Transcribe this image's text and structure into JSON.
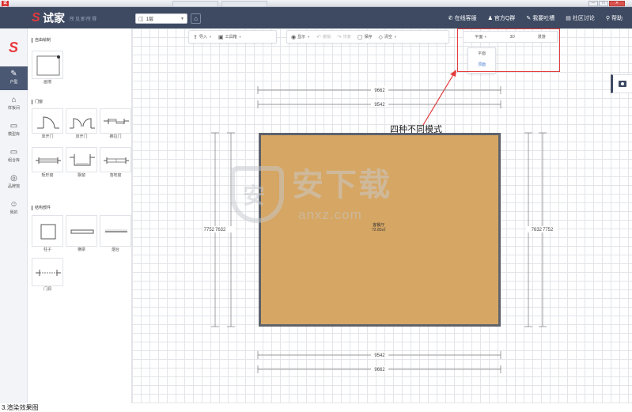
{
  "os_bar": {
    "app_icon_text": "试家",
    "title": ""
  },
  "header": {
    "logo_text": "试家",
    "logo_sub": "所见即所得",
    "floor_select": "1层",
    "links": [
      {
        "icon": "phone-icon",
        "glyph": "✆",
        "label": "在线客服"
      },
      {
        "icon": "user-icon",
        "glyph": "♟",
        "label": "官方Q群"
      },
      {
        "icon": "mic-icon",
        "glyph": "✎",
        "label": "我要吐槽"
      },
      {
        "icon": "forum-icon",
        "glyph": "▤",
        "label": "社区讨论"
      },
      {
        "icon": "search-icon",
        "glyph": "⚲",
        "label": "帮助"
      }
    ]
  },
  "left_nav": {
    "items": [
      {
        "key": "floorplan",
        "label": "户型",
        "glyph": "✎",
        "active": true
      },
      {
        "key": "samples",
        "label": "样板间",
        "glyph": "⌂",
        "active": false
      },
      {
        "key": "models",
        "label": "模型库",
        "glyph": "▭",
        "active": false
      },
      {
        "key": "groups",
        "label": "组合库",
        "glyph": "▭",
        "active": false
      },
      {
        "key": "brands",
        "label": "品牌馆",
        "glyph": "◎",
        "active": false
      },
      {
        "key": "mine",
        "label": "我的",
        "glyph": "☺",
        "active": false
      }
    ]
  },
  "panel": {
    "sections": [
      {
        "title": "自由绘制",
        "items": [
          "画墙"
        ]
      },
      {
        "title": "门窗",
        "items": [
          "单开门",
          "双开门",
          "推拉门",
          "矩形窗",
          "飘窗",
          "落地窗"
        ]
      },
      {
        "title": "结构部件",
        "items": [
          "柱子",
          "横梁",
          "烟台",
          "门洞"
        ]
      }
    ]
  },
  "toolbar": {
    "import": "导入",
    "toolbox": "工具箱",
    "show": "显示",
    "undo": "撤销",
    "redo": "恢复",
    "save": "保存",
    "clear": "清空"
  },
  "mode_bar": {
    "current": "平面",
    "options": [
      "3D",
      "漫游"
    ],
    "dropdown": [
      "平面",
      "顶面"
    ]
  },
  "drawing": {
    "dim_top_outer": "9662",
    "dim_top_inner": "9542",
    "dim_bottom_inner": "9542",
    "dim_bottom_outer": "9662",
    "dim_left_outer": "7752",
    "dim_left_inner": "7632",
    "dim_right_inner": "7632",
    "dim_right_outer": "7752",
    "room_name": "客餐厅",
    "room_area": "72.83㎡",
    "floor_color": "#d6a664",
    "wall_color": "#5f636b"
  },
  "annotation": "四种不同模式",
  "watermark": {
    "cn": "安下载",
    "en": "anxz.com"
  },
  "caption": "3.渲染效果图"
}
